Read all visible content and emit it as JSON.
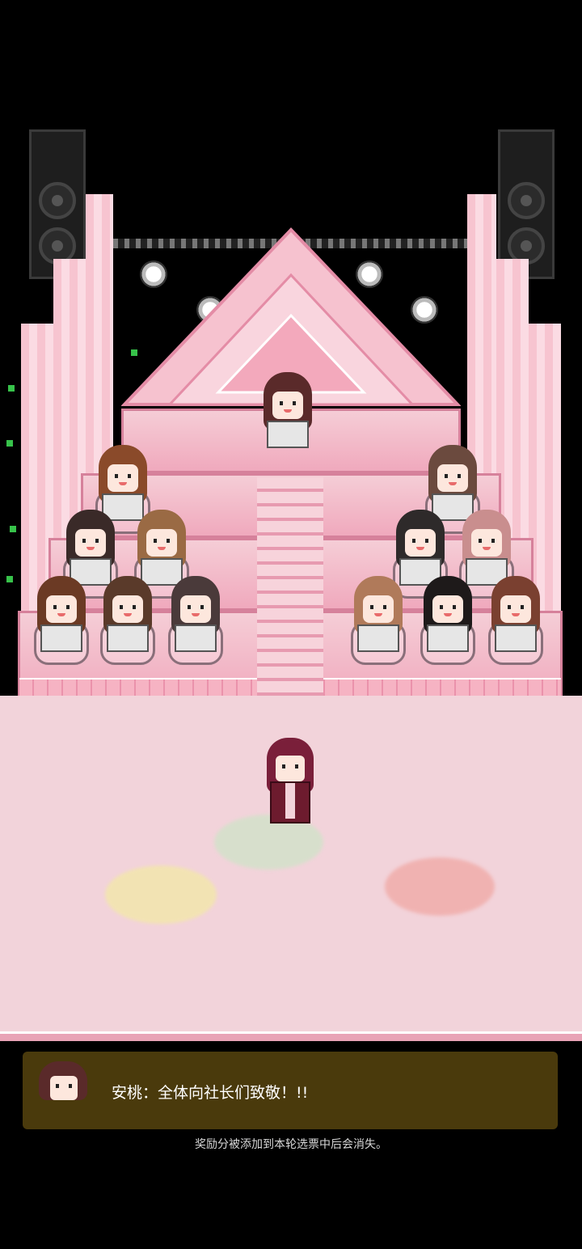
{
  "dialog": {
    "speaker": "安桃",
    "message": "全体向社长们致敬！!!",
    "line": "安桃：全体向社长们致敬！!!"
  },
  "notice": "奖励分被添加到本轮选票中后会消失。",
  "colors": {
    "background": "#000000",
    "floor": "#f2d3da",
    "stage_pink": "#f0a9bd",
    "dialog_box": "#4a3a0c"
  },
  "members": [
    {
      "hair": "#8a4a2a"
    },
    {
      "hair": "#3a2a28"
    },
    {
      "hair": "#9a6a44"
    },
    {
      "hair": "#6b3a24"
    },
    {
      "hair": "#5a3a2a"
    },
    {
      "hair": "#4a3a3a"
    },
    {
      "hair": "#6b4a3e"
    },
    {
      "hair": "#2e2a2a"
    },
    {
      "hair": "#c98e8e"
    },
    {
      "hair": "#b07a5a"
    },
    {
      "hair": "#1e1a1a"
    },
    {
      "hair": "#7a4030"
    }
  ]
}
